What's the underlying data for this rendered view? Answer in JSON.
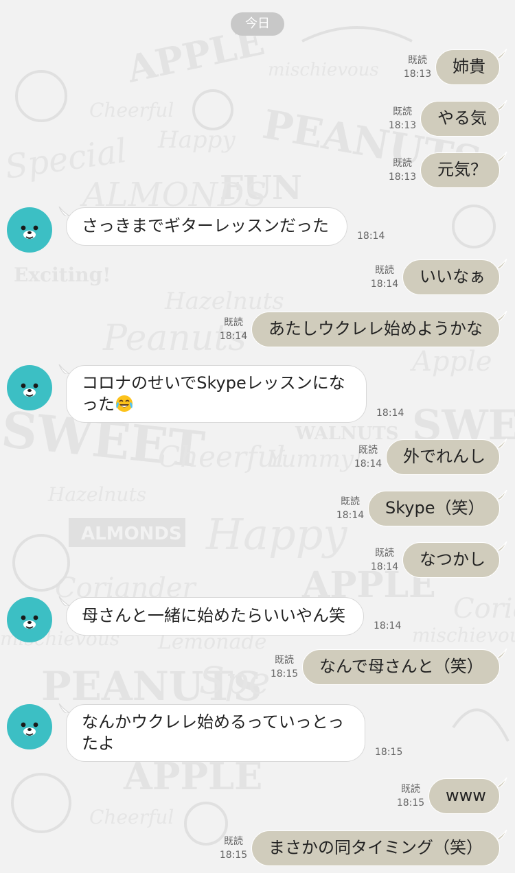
{
  "date_label": "今日",
  "read_label": "既読",
  "messages": [
    {
      "dir": "sent",
      "text": "姉貴",
      "time": "18:13"
    },
    {
      "dir": "sent",
      "text": "やる気",
      "time": "18:13"
    },
    {
      "dir": "sent",
      "text": "元気？",
      "time": "18:13"
    },
    {
      "dir": "recv",
      "text": "さっきまでギターレッスンだった",
      "time": "18:14"
    },
    {
      "dir": "sent",
      "text": "いいなぁ",
      "time": "18:14"
    },
    {
      "dir": "sent",
      "text": "あたしウクレレ始めようかな",
      "time": "18:14"
    },
    {
      "dir": "recv",
      "text": "コロナのせいでSkypeレッスンになった",
      "emoji": "face-with-tears-of-joy-icon",
      "time": "18:14"
    },
    {
      "dir": "sent",
      "text": "外でれんし",
      "time": "18:14"
    },
    {
      "dir": "sent",
      "text": "Skype（笑）",
      "time": "18:14"
    },
    {
      "dir": "sent",
      "text": "なつかし",
      "time": "18:14"
    },
    {
      "dir": "recv",
      "text": "母さんと一緒に始めたらいいやん笑",
      "time": "18:14"
    },
    {
      "dir": "sent",
      "text": "なんで母さんと（笑）",
      "time": "18:15"
    },
    {
      "dir": "recv",
      "text": "なんかウクレレ始めるっていっとったよ",
      "time": "18:15"
    },
    {
      "dir": "sent",
      "text": "www",
      "time": "18:15"
    },
    {
      "dir": "sent",
      "text": "まさかの同タイミング（笑）",
      "time": "18:15"
    }
  ],
  "background_words": [
    "APPLE",
    "mischievous",
    "Cheerful",
    "Special",
    "Happy",
    "PEANUTS",
    "FUN",
    "ALMONDS",
    "Exciting!",
    "Hazelnuts",
    "Peanuts",
    "Apple",
    "SWEET",
    "WALNUTS",
    "Yummy!",
    "Lemonade",
    "Coriander"
  ],
  "colors": {
    "background": "#f2f2f2",
    "sent_bubble": "#d0ccbc",
    "recv_bubble": "#ffffff",
    "avatar": "#3cbfc4",
    "date_pill": "#c8c8c8"
  }
}
